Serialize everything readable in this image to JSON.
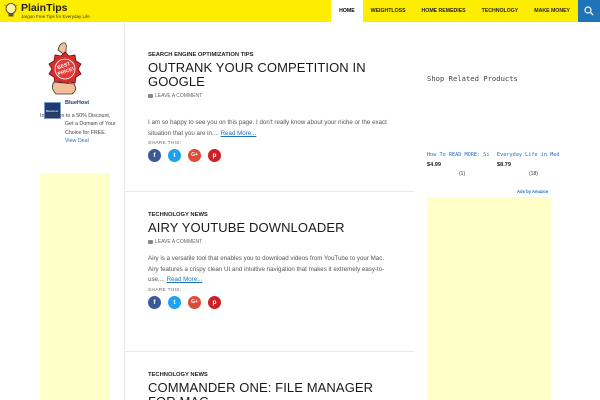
{
  "site": {
    "title": "PlainTips",
    "tagline": "Jargon Free Tips for Everyday Life"
  },
  "nav": {
    "items": [
      {
        "label": "Home",
        "active": true
      },
      {
        "label": "Weightloss",
        "active": false
      },
      {
        "label": "Home Remedies",
        "active": false
      },
      {
        "label": "Technology",
        "active": false
      },
      {
        "label": "Make Money",
        "active": false
      }
    ],
    "search_icon": "search-icon"
  },
  "left_sidebar": {
    "badge_text": "BEST PRICE!",
    "promo_logo_text": "BlueHost",
    "promo_name": "BlueHost",
    "promo_text": "In addition to a 50% Discount, Get a Domain of Your Choice for FREE.",
    "promo_link": "View Deal"
  },
  "posts": [
    {
      "category": "Search Engine Optimization Tips",
      "title": "Outrank Your Competition in Google",
      "comment": "Leave a Comment",
      "excerpt": "I am so happy to see you on this page. I don't really know about your niche or the exact situation that you are in....",
      "read_more": "Read More...",
      "share_label": "SHARE THIS:"
    },
    {
      "category": "Technology News",
      "title": "Airy YouTube Downloader",
      "comment": "Leave a Comment",
      "excerpt": "Airy is a versatile tool that enables you to download videos from YouTube to your Mac. Airy features a crispy clean UI and intuitive navigation that makes it extremely easy-to-use,...",
      "read_more": "Read More...",
      "share_label": "SHARE THIS:"
    },
    {
      "category": "Technology News",
      "title": "Commander One: File Manager for Mac"
    }
  ],
  "share_buttons": {
    "facebook": "f",
    "twitter": "t",
    "googleplus": "G+",
    "pinterest": "p"
  },
  "right_sidebar": {
    "shop_title": "Shop Related Products",
    "products": [
      {
        "title": "How To READ MORE: Simple Steps To...",
        "price": "$4.99",
        "reviews": "(1)"
      },
      {
        "title": "Everyday Life in Medieval London:...",
        "price": "$8.79",
        "reviews": "(18)"
      }
    ],
    "ads_by": "Ads by Amazon"
  },
  "colors": {
    "header_bg": "#ffed00",
    "search_bg": "#1f74b8",
    "ad_placeholder": "#ffffc8",
    "link": "#1e73be"
  }
}
